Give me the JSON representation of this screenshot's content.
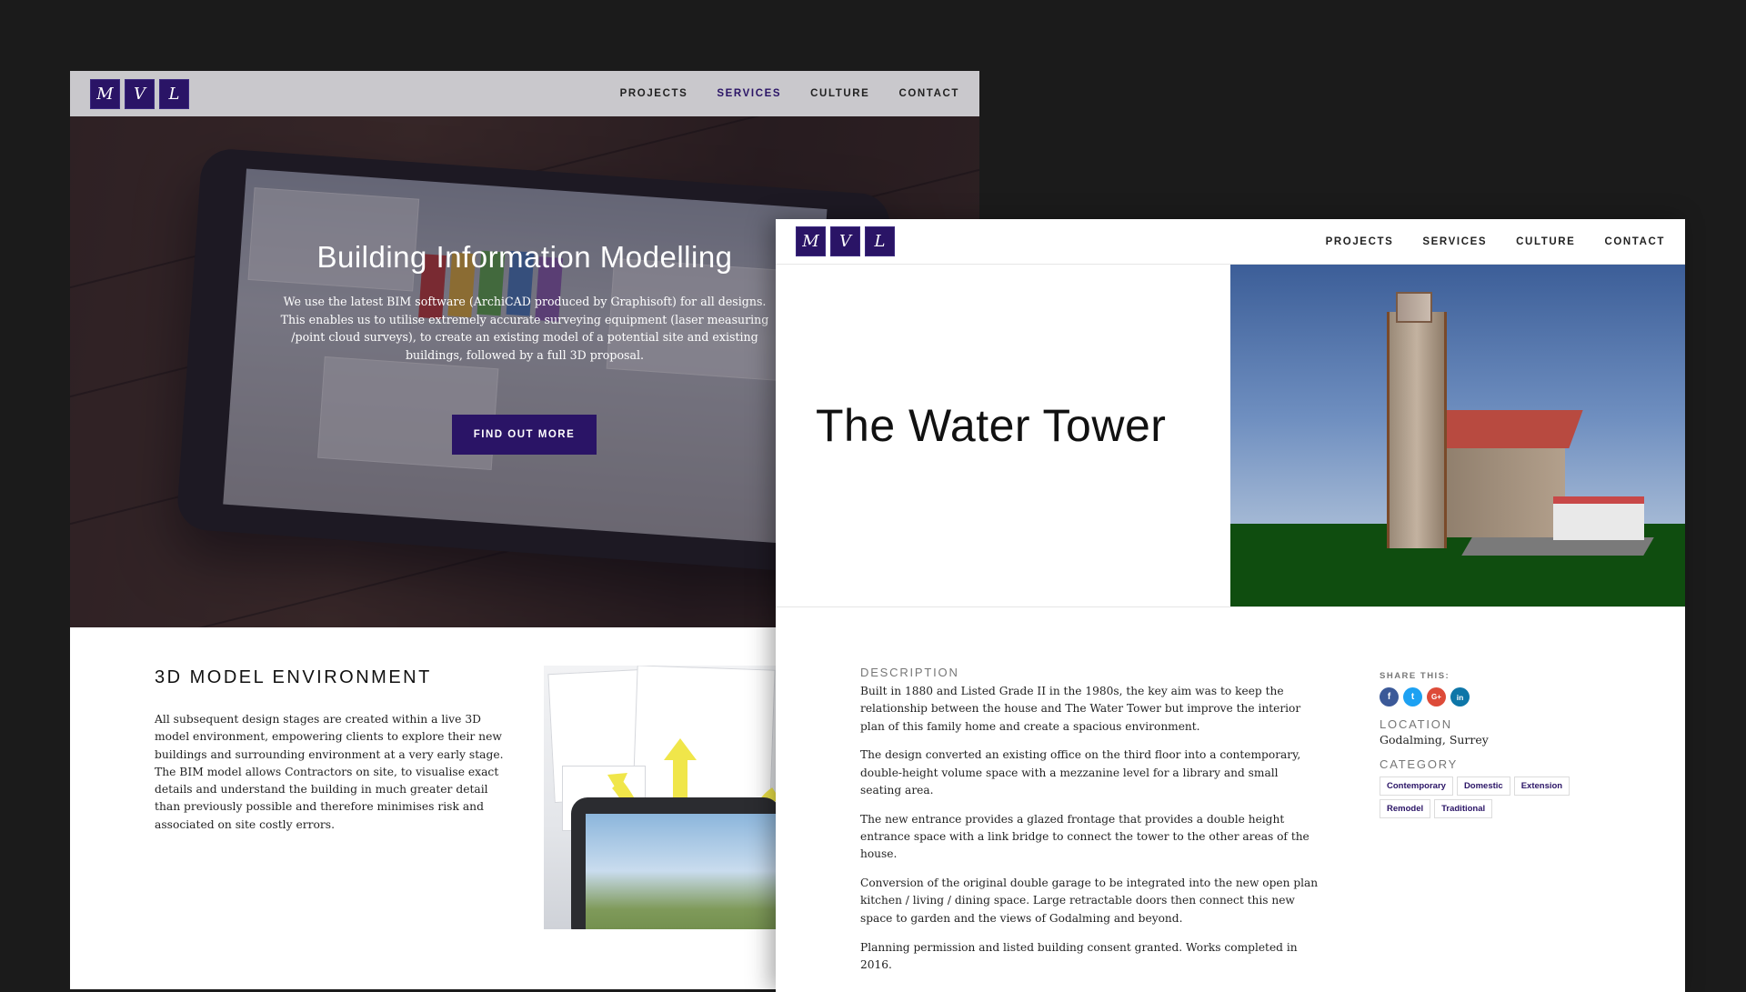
{
  "logo": {
    "letters": [
      "M",
      "V",
      "L"
    ]
  },
  "nav": {
    "projects": "PROJECTS",
    "services": "SERVICES",
    "culture": "CULTURE",
    "contact": "CONTACT"
  },
  "colors": {
    "brand": "#2a1466",
    "page_bg": "#1b1b1b"
  },
  "back_page": {
    "hero": {
      "title": "Building Information Modelling",
      "text": "We use the latest BIM software (ArchiCAD produced by Graphisoft) for all designs. This enables us to utilise extremely accurate surveying equipment (laser measuring /point cloud surveys), to create an existing model of a potential site and existing buildings, followed by a full 3D proposal.",
      "button": "FIND OUT MORE"
    },
    "section": {
      "heading": "3D MODEL ENVIRONMENT",
      "body": "All subsequent design stages are created within a live 3D model environment, empowering clients to explore their new buildings and surrounding environment at a very early stage. The BIM model allows Contractors on site, to visualise exact details and understand the building in much greater detail than previously possible and therefore minimises risk and associated on site costly errors."
    }
  },
  "front_page": {
    "title": "The Water Tower",
    "description_label": "DESCRIPTION",
    "paragraphs": [
      "Built in 1880 and Listed Grade II in the 1980s, the key aim was to keep the relationship between the house and The Water Tower but improve the interior plan of this family home and create a spacious environment.",
      "The design converted an existing office on the third floor into a contemporary, double-height volume space with a mezzanine level for a library and small seating area.",
      "The new entrance provides a glazed frontage that provides a double height entrance space with a link bridge to connect the tower to the other areas of the house.",
      "Conversion of the original double garage to be integrated into the new open plan kitchen / living / dining space. Large retractable doors then connect this new space to garden and the views of Godalming and beyond.",
      "Planning permission and listed building consent granted. Works completed in 2016."
    ],
    "share_label": "SHARE THIS:",
    "share_icons": [
      {
        "name": "facebook",
        "glyph": "f",
        "color": "#3b5998"
      },
      {
        "name": "twitter",
        "glyph": "t",
        "color": "#1da1f2"
      },
      {
        "name": "google-plus",
        "glyph": "G+",
        "color": "#dd4b39"
      },
      {
        "name": "linkedin",
        "glyph": "in",
        "color": "#0e76a8"
      }
    ],
    "location_label": "LOCATION",
    "location": "Godalming, Surrey",
    "category_label": "CATEGORY",
    "categories": [
      "Contemporary",
      "Domestic",
      "Extension",
      "Remodel",
      "Traditional"
    ]
  }
}
